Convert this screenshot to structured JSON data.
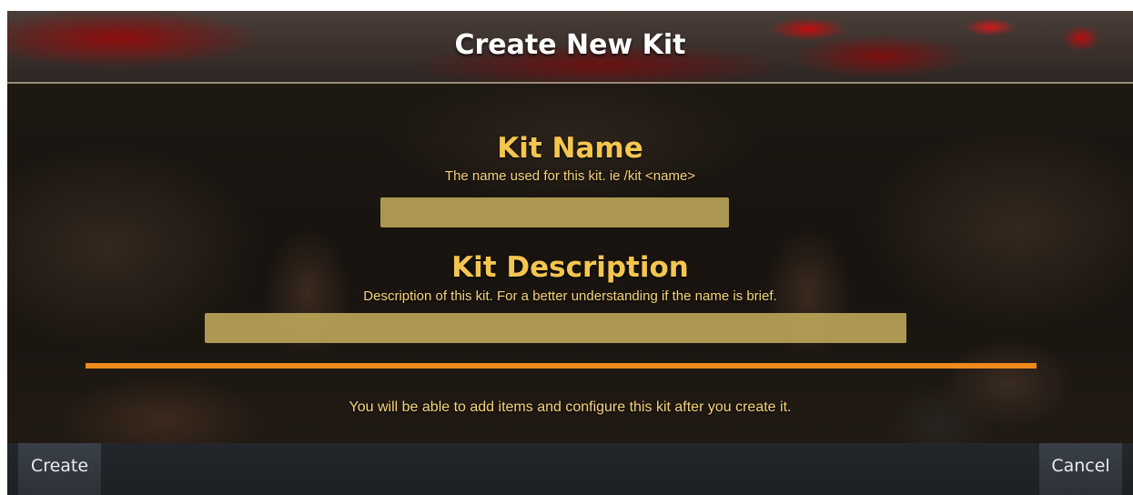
{
  "dialog": {
    "title": "Create New Kit"
  },
  "kit_name": {
    "title": "Kit Name",
    "description": "The name used for this kit. ie /kit <name>",
    "value": ""
  },
  "kit_description": {
    "title": "Kit Description",
    "description": "Description of this kit.  For a better understanding if the name is brief.",
    "value": ""
  },
  "info": {
    "message": "You will be able to add items and configure this kit after you create it."
  },
  "buttons": {
    "create_label": "Create",
    "cancel_label": "Cancel"
  },
  "colors": {
    "accent_gold": "#f4c64f",
    "input_fill": "#cdb45f",
    "divider_orange": "#f08a1c",
    "button_bg": "#343a41"
  }
}
